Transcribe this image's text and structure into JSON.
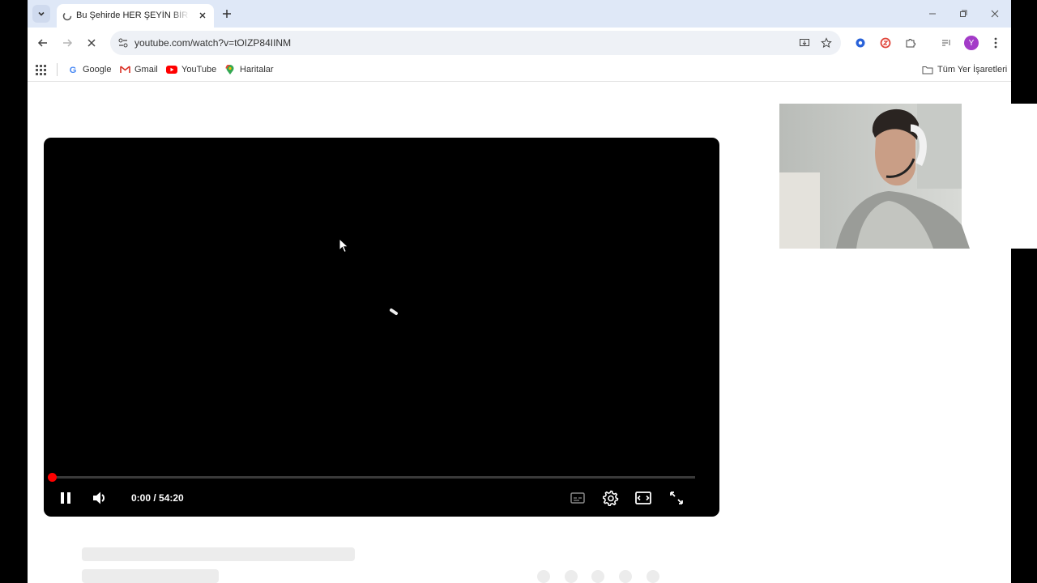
{
  "browser": {
    "tab_list_icon": "chevron-down-icon",
    "active_tab": {
      "title": "Bu Şehirde HER ŞEYİN BİR FİYATI VAR",
      "favicon": "loading-favicon-icon",
      "close_icon": "close-icon"
    },
    "new_tab_icon": "plus-icon",
    "window_controls": [
      "minimize-icon",
      "restore-icon",
      "close-icon"
    ]
  },
  "toolbar": {
    "back_icon": "back-arrow-icon",
    "forward_icon": "forward-arrow-icon",
    "stop_icon": "stop-loading-icon",
    "url": "youtube.com/watch?v=tOIZP84IINM",
    "right_icons": [
      "install-app-icon",
      "bookmark-star-icon",
      "extension-blue-icon",
      "extension-red-icon",
      "extensions-puzzle-icon",
      "reading-list-icon"
    ],
    "profile_initial": "Y",
    "profile_color": "#a33bc8"
  },
  "bookmarks": {
    "apps_icon": "apps-grid-icon",
    "items": [
      {
        "label": "Google",
        "icon": "google-icon"
      },
      {
        "label": "Gmail",
        "icon": "gmail-icon"
      },
      {
        "label": "YouTube",
        "icon": "youtube-icon"
      },
      {
        "label": "Haritalar",
        "icon": "maps-icon"
      }
    ],
    "all_bookmarks": "Tüm Yer İşaretleri"
  },
  "player": {
    "time": "0:00 / 54:20",
    "progress_fraction": 0.0,
    "accent": "#ff0000",
    "state": "loading"
  }
}
